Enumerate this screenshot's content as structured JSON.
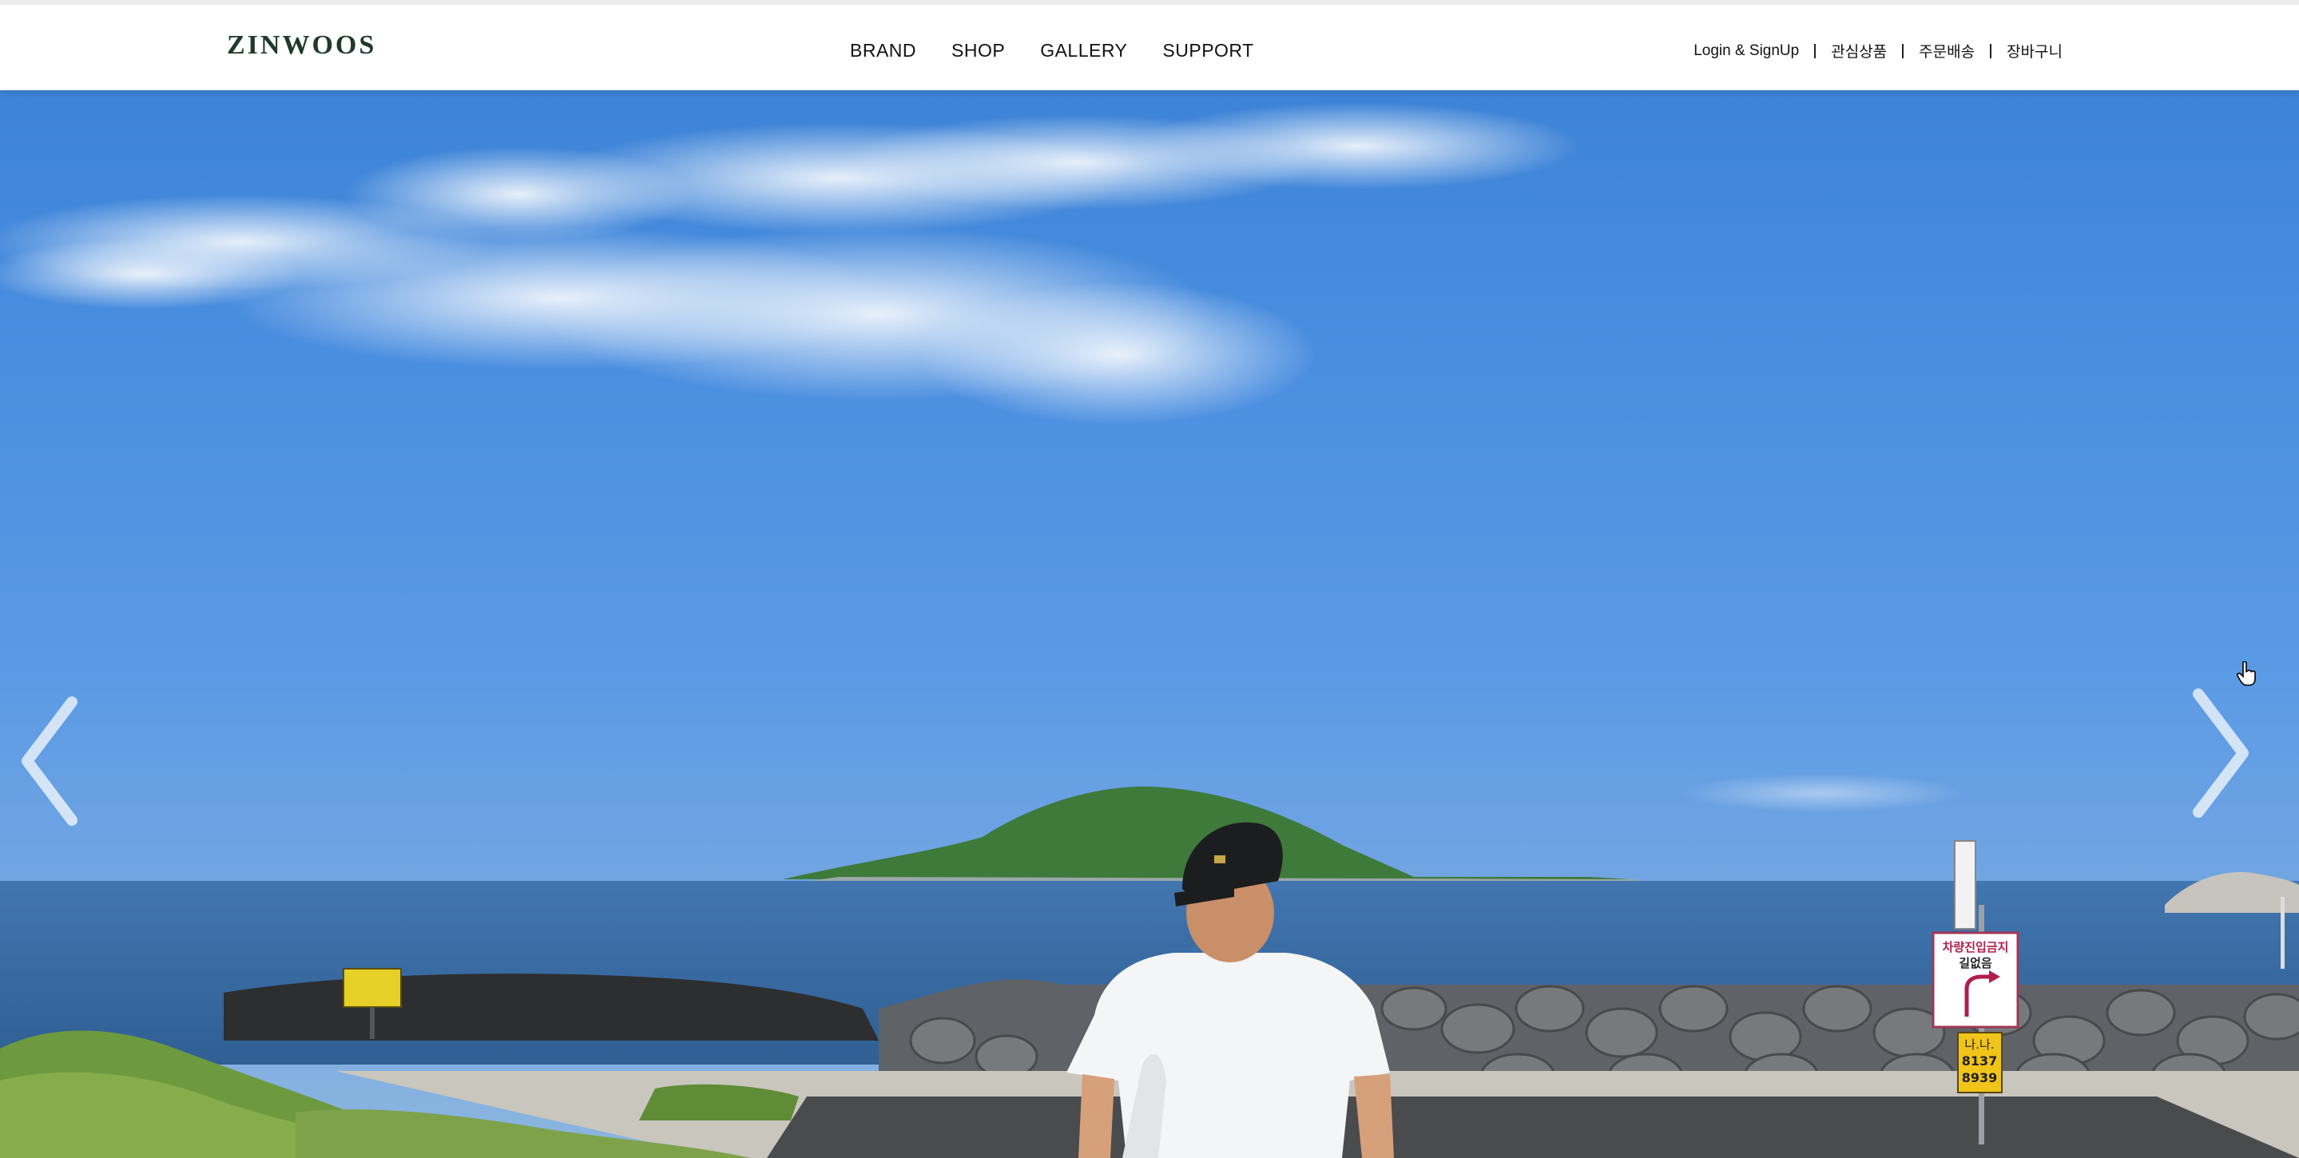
{
  "brand": {
    "logo_text": "ZINWOOS"
  },
  "nav": {
    "items": [
      {
        "label": "BRAND"
      },
      {
        "label": "SHOP"
      },
      {
        "label": "GALLERY"
      },
      {
        "label": "SUPPORT"
      }
    ]
  },
  "utility": {
    "login": "Login & SignUp",
    "wishlist": "관심상품",
    "orders": "주문배송",
    "cart": "장바구니"
  },
  "hero": {
    "sign_title": "차량진입금지",
    "sign_sub": "길없음",
    "plate_line1": "나.나.",
    "plate_line2": "8137",
    "plate_line3": "8939",
    "prev_icon": "chevron-left-icon",
    "next_icon": "chevron-right-icon"
  },
  "colors": {
    "logo": "#1e3a2c",
    "sky_top": "#3d83d6",
    "sea": "#3a6fa6",
    "arrow": "rgba(255,255,255,0.75)"
  }
}
